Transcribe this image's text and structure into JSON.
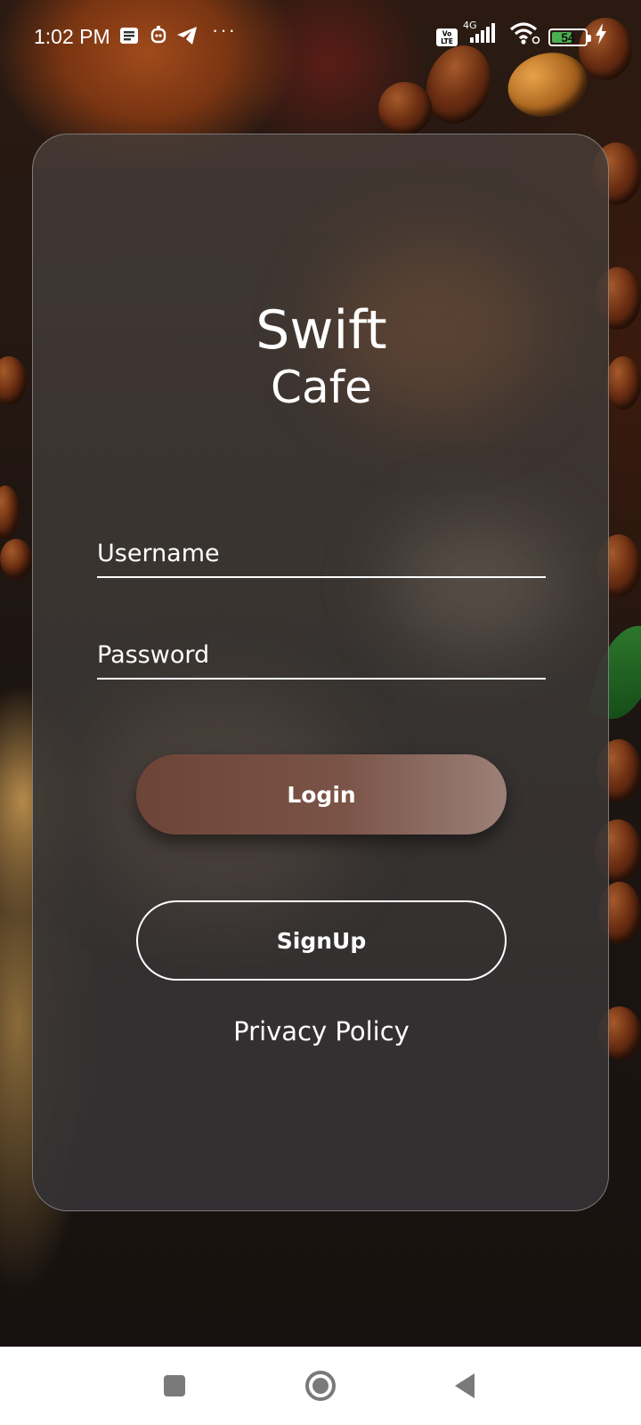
{
  "status_bar": {
    "time": "1:02 PM",
    "icons": [
      "notification-icon",
      "bot-icon",
      "telegram-icon",
      "more-icon",
      "volte-icon",
      "signal-icon",
      "wifi-icon",
      "battery-icon",
      "charging-icon"
    ],
    "more": "···",
    "volte_label": "Vo LTE",
    "network": "4G",
    "battery_level": "54",
    "battery_fraction": 0.54
  },
  "app": {
    "title_line1": "Swift",
    "title_line2": "Cafe"
  },
  "form": {
    "username_placeholder": "Username",
    "username_value": "",
    "password_placeholder": "Password",
    "password_value": ""
  },
  "buttons": {
    "login": "Login",
    "signup": "SignUp"
  },
  "links": {
    "privacy": "Privacy Policy"
  },
  "nav": {
    "icons": [
      "recents-icon",
      "home-icon",
      "back-icon"
    ]
  },
  "colors": {
    "login_gradient_start": "#6d4538",
    "login_gradient_end": "#9c8078",
    "battery_fill": "#4caf50"
  }
}
